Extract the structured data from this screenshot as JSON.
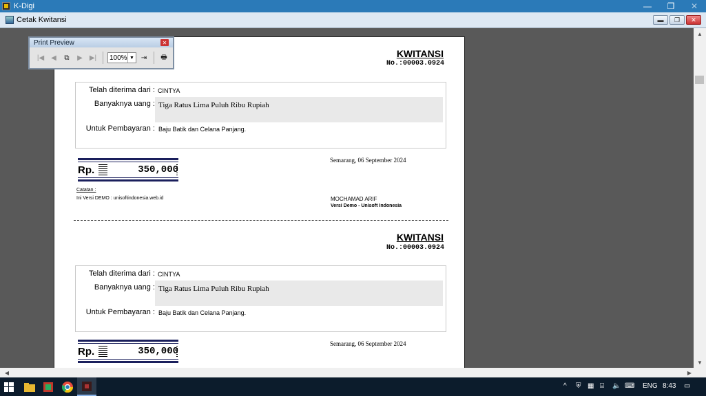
{
  "window": {
    "title": "K-Digi",
    "min": "—",
    "restore": "❐",
    "close": "✕"
  },
  "form": {
    "title": "Cetak Kwitansi"
  },
  "print_preview": {
    "title": "Print Preview",
    "zoom": "100%",
    "tools": {
      "first": "|◀",
      "prev": "◀",
      "copy": "⧉",
      "next": "▶",
      "last": "▶|",
      "export": "⇥",
      "print": "🖶"
    }
  },
  "receipts": [
    {
      "title": "KWITANSI",
      "number": "No.:00003.0924",
      "received_from_label": "Telah diterima dari :",
      "received_from": "CINTYA",
      "amount_words_label": "Banyaknya uang :",
      "amount_words": "Tiga Ratus Lima Puluh Ribu Rupiah",
      "payment_for_label": "Untuk Pembayaran :",
      "payment_for": "Baju Batik dan Celana Panjang.",
      "currency": "Rp.",
      "amount": "350,000",
      "place_date": "Semarang, 06 September 2024",
      "note_label": "Catatan :",
      "note": "Ini Versi DEMO : unisoftindonesia.web.id",
      "signer": "MOCHAMAD ARIF",
      "signer_note": "Versi Demo - Unisoft Indonesia"
    },
    {
      "title": "KWITANSI",
      "number": "No.:00003.0924",
      "received_from_label": "Telah diterima dari :",
      "received_from": "CINTYA",
      "amount_words_label": "Banyaknya uang :",
      "amount_words": "Tiga Ratus Lima Puluh Ribu Rupiah",
      "payment_for_label": "Untuk Pembayaran :",
      "payment_for": "Baju Batik dan Celana Panjang.",
      "currency": "Rp.",
      "amount": "350,000",
      "place_date": "Semarang, 06 September 2024"
    }
  ],
  "taskbar": {
    "language": "ENG",
    "time": "8:43"
  }
}
